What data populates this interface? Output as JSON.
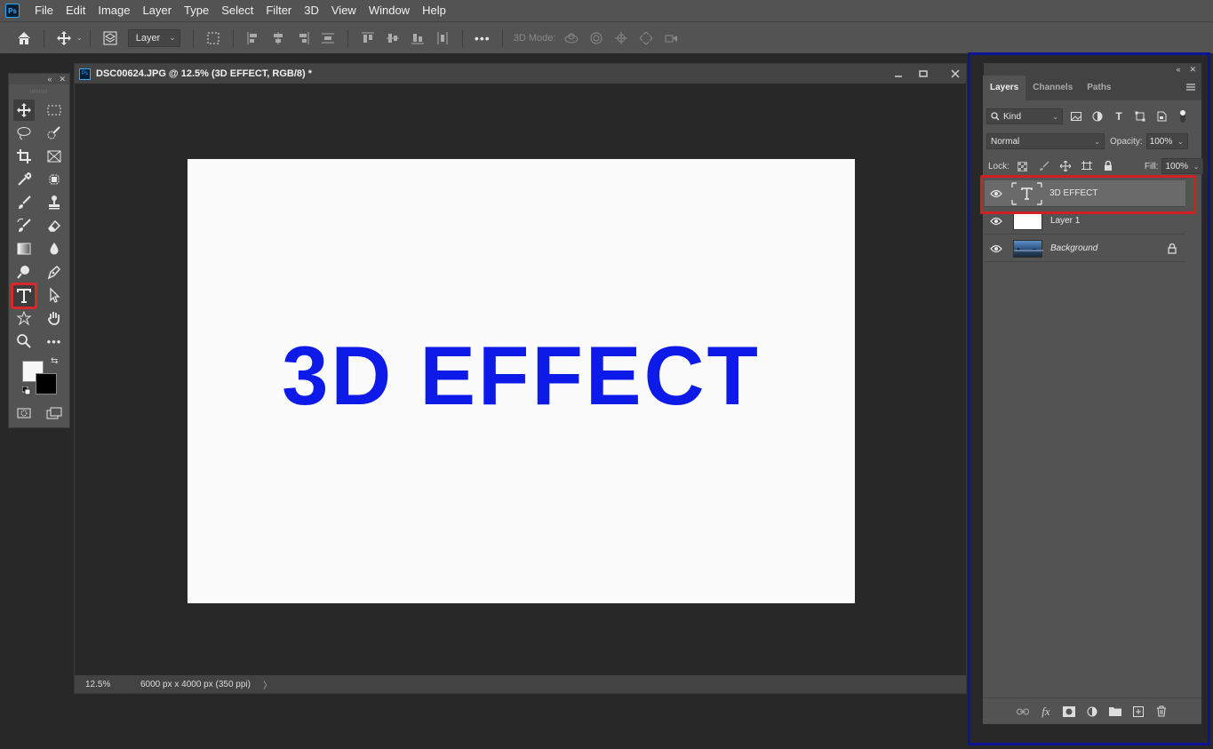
{
  "app": {
    "logo": "Ps",
    "menu": [
      "File",
      "Edit",
      "Image",
      "Layer",
      "Type",
      "Select",
      "Filter",
      "3D",
      "View",
      "Window",
      "Help"
    ]
  },
  "options_bar": {
    "auto_select_target": "Layer",
    "mode_label": "3D Mode:"
  },
  "document": {
    "tab_icon": "Ps",
    "title": "DSC00624.JPG @ 12.5% (3D EFFECT, RGB/8) *",
    "canvas_text": "3D EFFECT",
    "canvas_text_color": "#0e1ae8",
    "canvas_color": "#fbfbfb",
    "status": {
      "zoom": "12.5%",
      "size": "6000 px x 4000 px (350 ppi)",
      "arrow": "〉"
    }
  },
  "tools": {
    "selected": "type-tool",
    "highlight_color": "#d8272d"
  },
  "layers_panel": {
    "tabs": [
      "Layers",
      "Channels",
      "Paths"
    ],
    "filter_kind": "Kind",
    "blend_mode": "Normal",
    "opacity_label": "Opacity:",
    "opacity": "100%",
    "lock_label": "Lock:",
    "fill_label": "Fill:",
    "fill": "100%",
    "layers": [
      {
        "name": "3D EFFECT",
        "kind": "type",
        "selected": true
      },
      {
        "name": "Layer 1",
        "kind": "pixel",
        "selected": false
      },
      {
        "name": "Background",
        "kind": "image",
        "locked": true,
        "selected": false
      }
    ],
    "frame_color": "#0e1496"
  }
}
